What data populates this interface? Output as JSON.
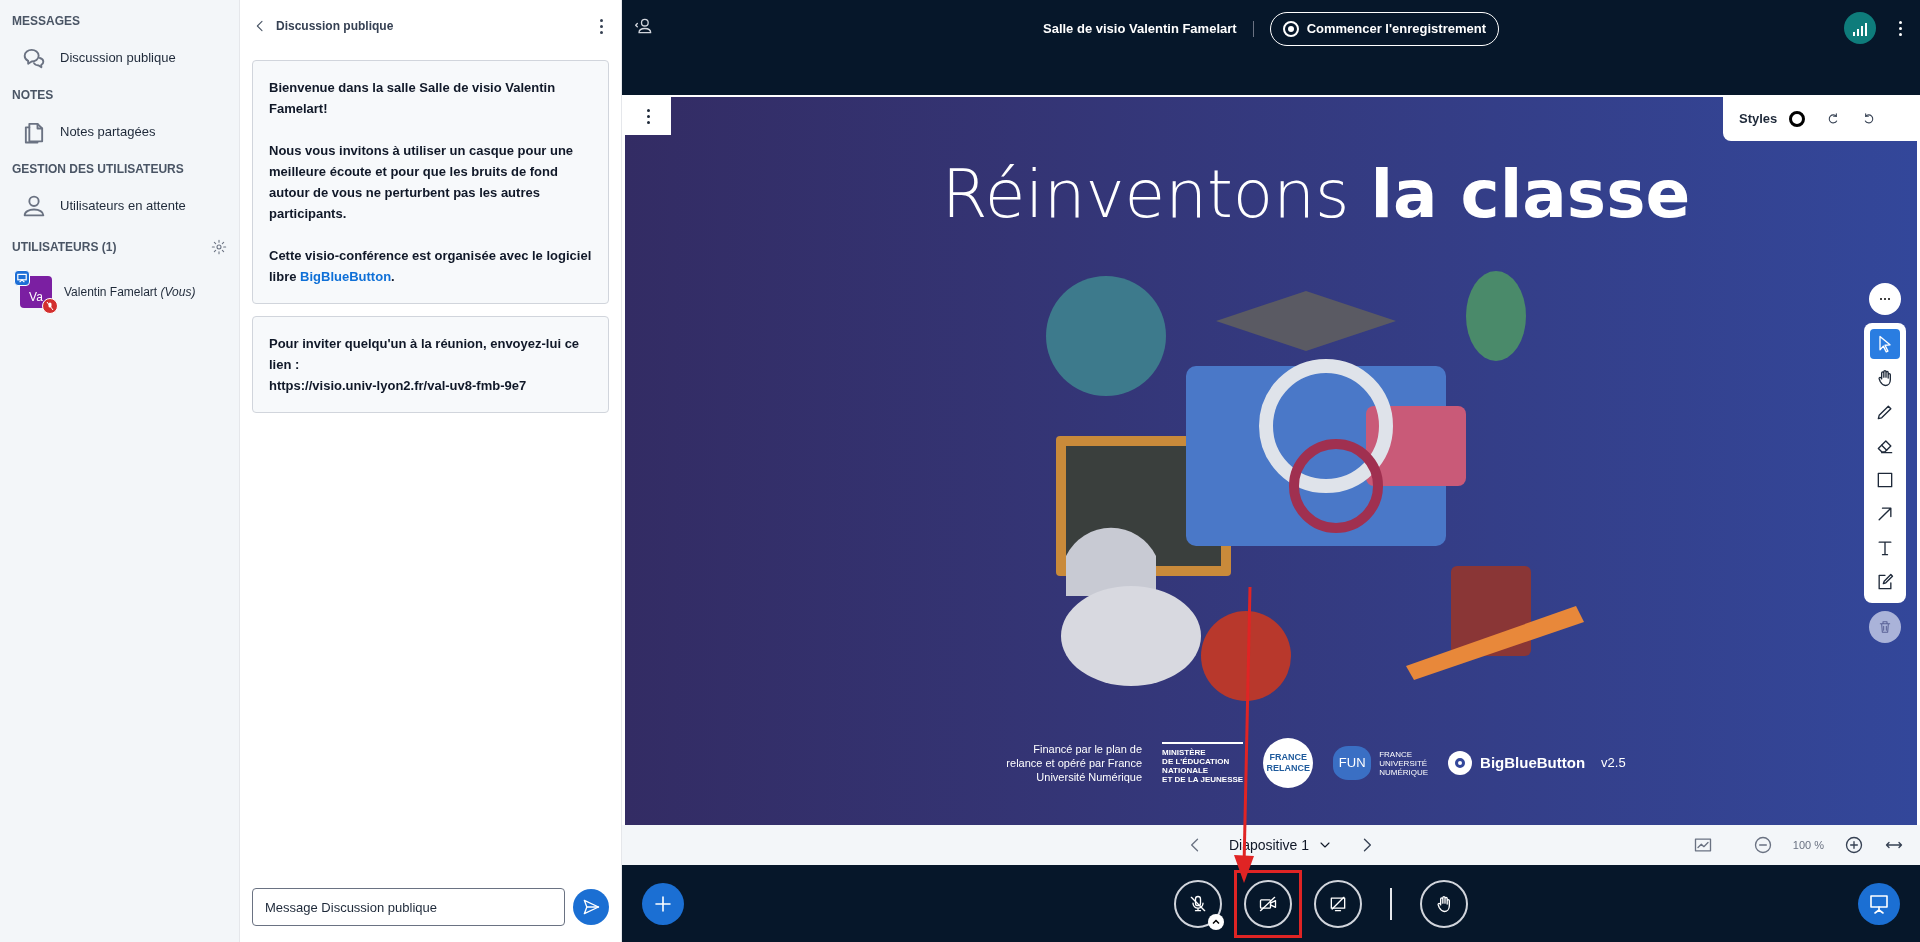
{
  "sidebar": {
    "sections": [
      {
        "title": "MESSAGES",
        "items": [
          {
            "label": "Discussion publique",
            "kind": "chat"
          }
        ]
      },
      {
        "title": "NOTES",
        "items": [
          {
            "label": "Notes partagées",
            "kind": "notes"
          }
        ]
      },
      {
        "title": "GESTION DES UTILISATEURS",
        "items": [
          {
            "label": "Utilisateurs en attente",
            "kind": "user"
          }
        ]
      }
    ],
    "users_title": "UTILISATEURS (1)",
    "users": [
      {
        "initials": "Va",
        "name": "Valentin Famelart",
        "suffix": "(Vous)",
        "presenter": true,
        "muted": true,
        "color": "#7b1fa2"
      }
    ]
  },
  "chat": {
    "title": "Discussion publique",
    "messages": [
      {
        "paragraphs": [
          {
            "text": "Bienvenue dans la salle **Salle de visio Valentin Famelart**!"
          },
          {
            "text": "Nous vous invitons à utiliser un casque pour une meilleure écoute et pour que les bruits de fond autour de vous ne perturbent pas les autres participants."
          },
          {
            "text": "Cette visio-conférence est organisée avec le logiciel libre",
            "link": "BigBlueButton",
            "after": "."
          }
        ]
      },
      {
        "paragraphs": [
          {
            "text": "Pour inviter quelqu'un à la réunion, envoyez-lui ce lien :",
            "url": "https://visio.univ-lyon2.fr/val-uv8-fmb-9e7"
          }
        ]
      }
    ],
    "input": {
      "placeholder": "Message Discussion publique"
    }
  },
  "topbar": {
    "title": "Salle de visio Valentin Famelart",
    "record_button": "Commencer l'enregistrement"
  },
  "whiteboard": {
    "styles_label": "Styles",
    "tools": [
      {
        "kind": "select",
        "selected": true
      },
      {
        "kind": "pan",
        "selected": false
      },
      {
        "kind": "pencil",
        "selected": false
      },
      {
        "kind": "eraser",
        "selected": false
      },
      {
        "kind": "rectangle",
        "selected": false
      },
      {
        "kind": "arrow",
        "selected": false
      },
      {
        "kind": "text",
        "selected": false
      },
      {
        "kind": "note",
        "selected": false
      }
    ]
  },
  "slide": {
    "title_light": "Réinventons",
    "title_bold": "la classe",
    "funding": [
      "Financé par le plan de",
      "relance et opéré par France",
      "Université Numérique"
    ],
    "ministry": [
      "MINISTÈRE",
      "DE L'ÉDUCATION",
      "NATIONALE",
      "ET DE LA JEUNESSE"
    ],
    "relance": [
      "FRANCE",
      "RELANCE"
    ],
    "fun": "FUN",
    "fun_caption": [
      "FRANCE",
      "UNIVERSITÉ",
      "NUMÉRIQUE"
    ],
    "bbb": "BigBlueButton",
    "version": "v2.5"
  },
  "slide_nav": {
    "slide": "Diapositive 1",
    "zoom": "100 %"
  },
  "actions": {
    "mic_muted": true,
    "camera_on": false,
    "screen_sharing": false
  }
}
